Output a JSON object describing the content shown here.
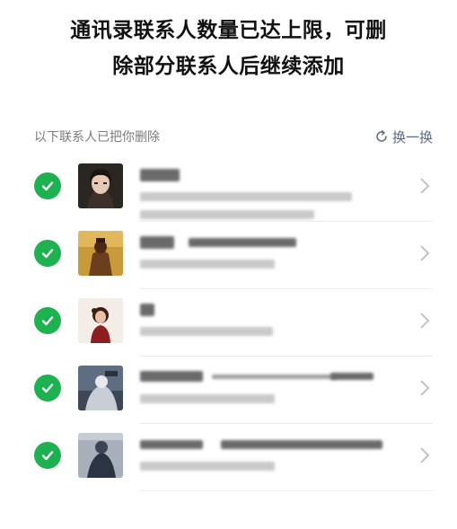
{
  "title": {
    "line1": "通讯录联系人数量已达上限，可删",
    "line2": "除部分联系人后继续添加"
  },
  "subheader": {
    "label": "以下联系人已把你删除",
    "refresh_label": "换一换",
    "refresh_icon": "refresh-icon"
  },
  "colors": {
    "check_green": "#1db14f",
    "link_blue": "#5b6b86",
    "muted_text": "#7c7c7c"
  },
  "contacts": [
    {
      "selected": true,
      "avatar": "avatar-1"
    },
    {
      "selected": true,
      "avatar": "avatar-2"
    },
    {
      "selected": true,
      "avatar": "avatar-3"
    },
    {
      "selected": true,
      "avatar": "avatar-4"
    },
    {
      "selected": true,
      "avatar": "avatar-5"
    }
  ]
}
